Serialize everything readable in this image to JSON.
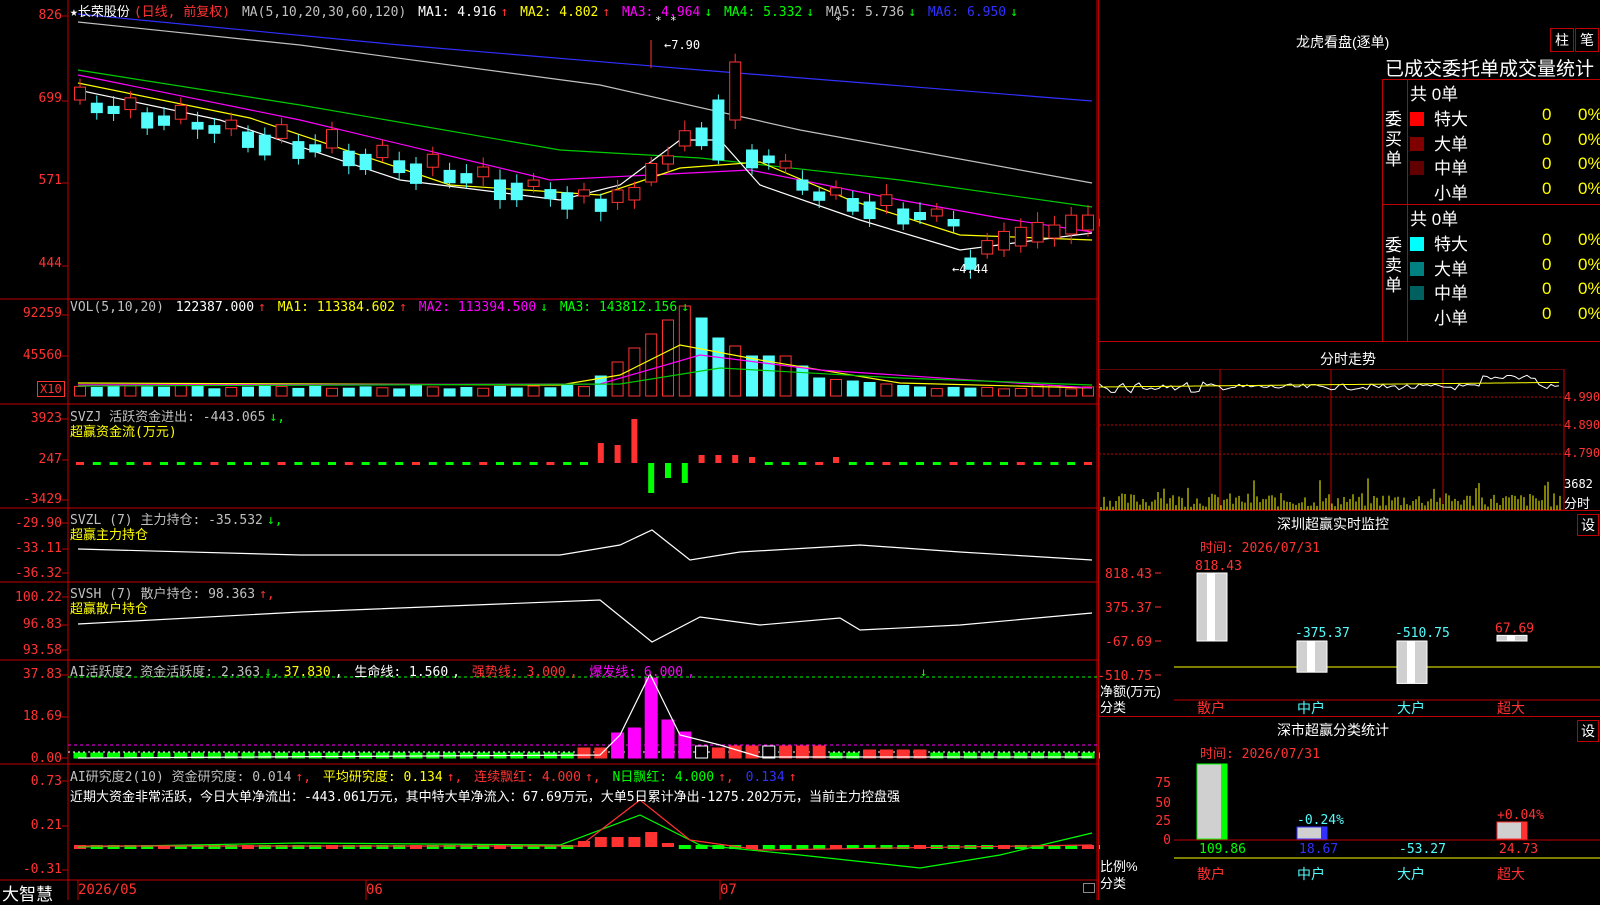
{
  "header": {
    "stock_name": "★长荣股份",
    "period": "(日线, 前复权)",
    "ma_label": "MA(5,10,20,30,60,120)",
    "ma1": "MA1: 4.916",
    "ma2": "MA2: 4.802",
    "ma3": "MA3: 4.964",
    "ma4": "MA4: 5.332",
    "ma5": "MA5: 5.736",
    "ma6": "MA6: 6.950"
  },
  "price_axis": [
    "826",
    "699",
    "571",
    "444"
  ],
  "price_notes": {
    "high": "7.90",
    "low": "4.44"
  },
  "vol": {
    "label": "VOL(5,10,20)",
    "value": "122387.000",
    "ma1": "MA1: 113384.602",
    "ma2": "MA2: 113394.500",
    "ma3": "MA3: 143812.156",
    "axis": [
      "92259",
      "45560"
    ],
    "unit": "X10"
  },
  "svzj": {
    "label": "SVZJ  活跃资金进出: -443.065",
    "sub": "超赢资金流(万元)",
    "axis": [
      "3923",
      "247",
      "-3429"
    ]
  },
  "svzl": {
    "label": "SVZL  (7) 主力持仓: -35.532",
    "sub": "超赢主力持仓",
    "axis": [
      "-29.90",
      "-33.11",
      "-36.32"
    ]
  },
  "svsh": {
    "label": "SVSH  (7) 散户持仓: 98.363",
    "sub": "超赢散户持仓",
    "axis": [
      "100.22",
      "96.83",
      "93.58"
    ]
  },
  "ai_act": {
    "label": "AI活跃度2 资金活跃度: 2.363",
    "v2": "37.830",
    "life": "生命线: 1.560",
    "strong": "强势线: 3.000",
    "burst": "爆发线: 6.000",
    "axis": [
      "37.83",
      "18.69",
      "0.00"
    ]
  },
  "ai_res": {
    "label": "AI研究度2(10) 资金研究度: 0.014",
    "avg": "平均研究度: 0.134",
    "cont": "连续飘红: 4.000",
    "nday": "N日飘红: 4.000",
    "last": "0.134",
    "axis": [
      "0.73",
      "0.21",
      "-0.31"
    ],
    "comment": "近期大资金非常活跃，今日大单净流出：-443.061万元，其中特大单净流入：67.69万元，大单5日累计净出-1275.202万元，当前主力控盘强"
  },
  "date_axis": {
    "brand": "大智慧",
    "labels": [
      "2026/05",
      "06",
      "07"
    ]
  },
  "right": {
    "lhb_title": "龙虎看盘(逐单)",
    "btn_zhu": "柱",
    "btn_bi": "笔",
    "section_title": "已成交委托单成交量统计",
    "buy_label": "委买单",
    "sell_label": "委卖单",
    "buy_total": "共 0单",
    "sell_total": "共 0单",
    "buy_rows": [
      {
        "name": "特大",
        "count": "0",
        "pct": "0%",
        "color": "#ff0000"
      },
      {
        "name": "大单",
        "count": "0",
        "pct": "0%",
        "color": "#800000"
      },
      {
        "name": "中单",
        "count": "0",
        "pct": "0%",
        "color": "#600000"
      },
      {
        "name": "小单",
        "count": "0",
        "pct": "0%",
        "color": "#000000"
      }
    ],
    "sell_rows": [
      {
        "name": "特大",
        "count": "0",
        "pct": "0%",
        "color": "#00ffff"
      },
      {
        "name": "大单",
        "count": "0",
        "pct": "0%",
        "color": "#008080"
      },
      {
        "name": "中单",
        "count": "0",
        "pct": "0%",
        "color": "#006060"
      },
      {
        "name": "小单",
        "count": "0",
        "pct": "0%",
        "color": "#000000"
      }
    ],
    "intraday_title": "分时走势",
    "intraday_axis": [
      "4.990",
      "4.890",
      "4.790"
    ],
    "intraday_vol": "3682",
    "intraday_unit": "分时",
    "sz_title": "深圳超赢实时监控",
    "sz_btn": "设",
    "sz_time": "时间: 2026/07/31",
    "sz_axis": [
      "818.43",
      "375.37",
      "-67.69",
      "-510.75"
    ],
    "sz_ylabel": "净额(万元)",
    "sz_xlabel": "分类",
    "sz_bars": [
      {
        "name": "散户",
        "value": "818.43",
        "v": 818.43
      },
      {
        "name": "中户",
        "value": "-375.37",
        "v": -375.37
      },
      {
        "name": "大户",
        "value": "-510.75",
        "v": -510.75
      },
      {
        "name": "超大",
        "value": "67.69",
        "v": 67.69
      }
    ],
    "sc_title": "深市超赢分类统计",
    "sc_btn": "设",
    "sc_time": "时间: 2026/07/31",
    "sc_axis": [
      "75",
      "50",
      "25",
      "0"
    ],
    "sc_ylabel": "比例%",
    "sc_xlabel": "分类",
    "sc_bars": [
      {
        "name": "散户",
        "pct": "",
        "value": "109.86",
        "v": 75
      },
      {
        "name": "中户",
        "pct": "-0.24%",
        "value": "18.67",
        "v": 12
      },
      {
        "name": "大户",
        "pct": "",
        "value": "-53.27",
        "v": 0
      },
      {
        "name": "超大",
        "pct": "+0.04%",
        "value": "24.73",
        "v": 17
      }
    ]
  }
}
